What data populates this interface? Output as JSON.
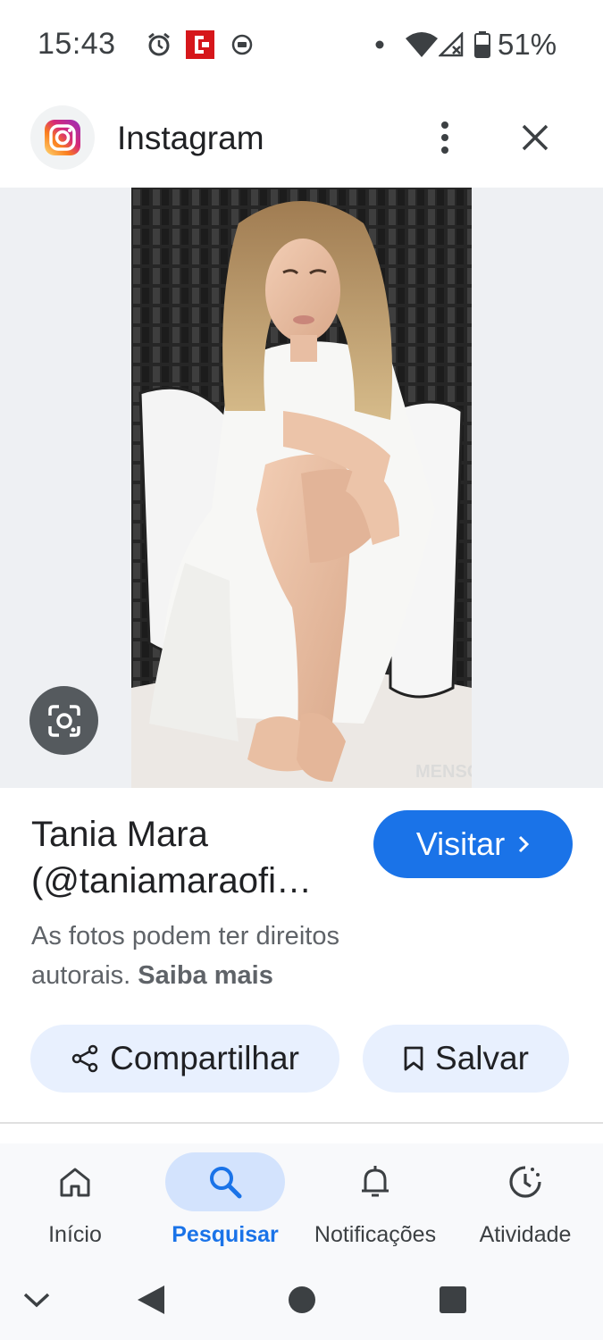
{
  "status_bar": {
    "time": "15:43",
    "battery_percent": "51%",
    "icons": [
      "alarm-icon",
      "news-app-icon",
      "cast-icon",
      "dot-icon",
      "wifi-icon",
      "signal-icon",
      "battery-icon"
    ]
  },
  "header": {
    "app_name": "Instagram",
    "app_icon": "instagram-logo-icon",
    "more_icon": "more-vert-icon",
    "close_icon": "close-icon"
  },
  "image": {
    "watermark": "MENSCI",
    "lens_icon": "google-lens-icon"
  },
  "result": {
    "title_line1": "Tania Mara",
    "title_line2": "(@taniamaraofi…",
    "visit_label": "Visitar",
    "copyright_text": "As fotos podem ter direitos autorais.",
    "learn_more": "Saiba mais",
    "share_label": "Compartilhar",
    "save_label": "Salvar"
  },
  "bottom_nav": {
    "items": [
      {
        "label": "Início",
        "icon": "home-icon",
        "active": false
      },
      {
        "label": "Pesquisar",
        "icon": "search-icon",
        "active": true
      },
      {
        "label": "Notificações",
        "icon": "bell-icon",
        "active": false
      },
      {
        "label": "Atividade",
        "icon": "activity-history-icon",
        "active": false
      }
    ]
  },
  "system_nav": {
    "icons": [
      "collapse-icon",
      "back-icon",
      "home-circle-icon",
      "recents-icon"
    ]
  },
  "colors": {
    "accent": "#1a73e8",
    "pill_bg": "#e8f0fe",
    "active_nav_bg": "#d3e3fd"
  }
}
